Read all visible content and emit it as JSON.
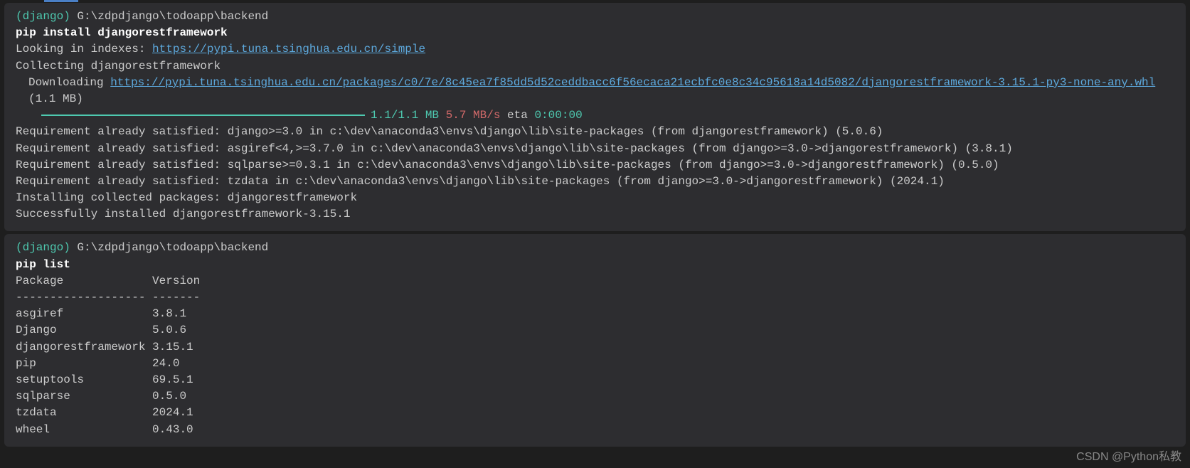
{
  "block1": {
    "env": "(django)",
    "path": " G:\\zdpdjango\\todoapp\\backend",
    "command": "pip install djangorestframework",
    "line1_prefix": "Looking in indexes: ",
    "line1_link": "https://pypi.tuna.tsinghua.edu.cn/simple",
    "line2": "Collecting djangorestframework",
    "line3_prefix": "Downloading ",
    "line3_link": "https://pypi.tuna.tsinghua.edu.cn/packages/c0/7e/8c45ea7f85dd5d52ceddbacc6f56ecaca21ecbfc0e8c34c95618a14d5082/djangorestframework-3.15.1-py3-none-any.whl",
    "line3_suffix": " (1.1 MB)",
    "progress_size": "1.1/1.1 MB",
    "progress_speed": " 5.7 MB/s",
    "progress_eta_label": " eta ",
    "progress_eta": "0:00:00",
    "req1": "Requirement already satisfied: django>=3.0 in c:\\dev\\anaconda3\\envs\\django\\lib\\site-packages (from djangorestframework) (5.0.6)",
    "req2": "Requirement already satisfied: asgiref<4,>=3.7.0 in c:\\dev\\anaconda3\\envs\\django\\lib\\site-packages (from django>=3.0->djangorestframework) (3.8.1)",
    "req3": "Requirement already satisfied: sqlparse>=0.3.1 in c:\\dev\\anaconda3\\envs\\django\\lib\\site-packages (from django>=3.0->djangorestframework) (0.5.0)",
    "req4": "Requirement already satisfied: tzdata in c:\\dev\\anaconda3\\envs\\django\\lib\\site-packages (from django>=3.0->djangorestframework) (2024.1)",
    "installing": "Installing collected packages: djangorestframework",
    "success": "Successfully installed djangorestframework-3.15.1"
  },
  "block2": {
    "env": "(django)",
    "path": " G:\\zdpdjango\\todoapp\\backend",
    "command": "pip list",
    "header": "Package             Version",
    "divider": "------------------- -------",
    "rows": [
      "asgiref             3.8.1",
      "Django              5.0.6",
      "djangorestframework 3.15.1",
      "pip                 24.0",
      "setuptools          69.5.1",
      "sqlparse            0.5.0",
      "tzdata              2024.1",
      "wheel               0.43.0"
    ]
  },
  "watermark": "CSDN @Python私教"
}
